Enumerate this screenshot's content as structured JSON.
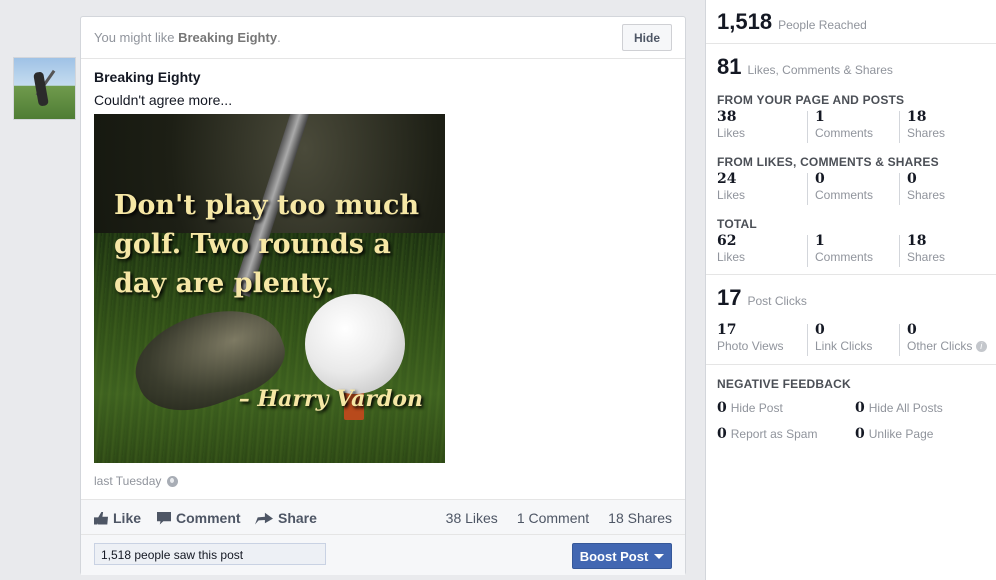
{
  "post": {
    "suggest_prefix": "You might like",
    "suggest_page": "Breaking Eighty",
    "suggest_suffix": ".",
    "hide_label": "Hide",
    "page_name": "Breaking Eighty",
    "text": "Couldn't agree more...",
    "image_quote": "Don't play too much golf.  Two rounds a day are plenty.",
    "image_author": "– Harry Vardon",
    "timestamp": "last Tuesday",
    "actions": {
      "like": "Like",
      "comment": "Comment",
      "share": "Share"
    },
    "counts": {
      "likes": "38 Likes",
      "comments": "1 Comment",
      "shares": "18 Shares"
    },
    "seen_text": "1,518 people saw this post",
    "boost_label": "Boost Post",
    "accent_color": "#4267b2"
  },
  "insights": {
    "reached": {
      "value": "1,518",
      "label": "People Reached"
    },
    "engagement": {
      "value": "81",
      "label": "Likes, Comments & Shares"
    },
    "groups": [
      {
        "title": "FROM YOUR PAGE AND POSTS",
        "likes": "38",
        "comments": "1",
        "shares": "18"
      },
      {
        "title": "FROM LIKES, COMMENTS & SHARES",
        "likes": "24",
        "comments": "0",
        "shares": "0"
      },
      {
        "title": "TOTAL",
        "likes": "62",
        "comments": "1",
        "shares": "18"
      }
    ],
    "labels": {
      "likes": "Likes",
      "comments": "Comments",
      "shares": "Shares"
    },
    "clicks": {
      "value": "17",
      "label": "Post Clicks",
      "photo_views": "17",
      "photo_views_label": "Photo Views",
      "link_clicks": "0",
      "link_clicks_label": "Link Clicks",
      "other_clicks": "0",
      "other_clicks_label": "Other Clicks",
      "info_glyph": "i"
    },
    "negative": {
      "title": "NEGATIVE FEEDBACK",
      "hide_post": "0",
      "hide_post_label": "Hide Post",
      "hide_all": "0",
      "hide_all_label": "Hide All Posts",
      "spam": "0",
      "spam_label": "Report as Spam",
      "unlike": "0",
      "unlike_label": "Unlike Page"
    }
  }
}
